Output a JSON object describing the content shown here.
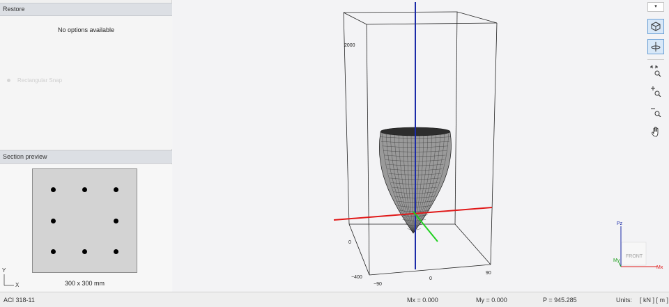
{
  "left_panel": {
    "restore": {
      "header": "Restore",
      "empty_message": "No options available",
      "snap_label": "Rectangular Snap"
    },
    "preview": {
      "header": "Section preview",
      "caption": "300 x 300 mm",
      "axis_y": "Y",
      "axis_x": "X",
      "rebars": [
        [
          0.2,
          0.2
        ],
        [
          0.5,
          0.2
        ],
        [
          0.8,
          0.2
        ],
        [
          0.2,
          0.5
        ],
        [
          0.8,
          0.5
        ],
        [
          0.2,
          0.8
        ],
        [
          0.5,
          0.8
        ],
        [
          0.8,
          0.8
        ]
      ]
    }
  },
  "viewport": {
    "tick_z": "2000",
    "tick_origin": "0",
    "tick_neg400": "−400",
    "tick_neg90": "−90",
    "tick_zero_x": "0",
    "tick_90": "90",
    "orient": {
      "pz": "Pz",
      "mx": "Mx",
      "my": "My",
      "cube": "FRONT"
    },
    "colors": {
      "z_axis": "#1a2aa8",
      "x_axis": "#e01818",
      "y_axis": "#20d020",
      "surface": "#9a9a9a",
      "mesh": "#2b2b2b"
    }
  },
  "toolbar": {
    "dropdown": "▾",
    "buttons": [
      "3d-view",
      "rotate",
      "zoom-extents",
      "zoom-in",
      "zoom-out",
      "pan"
    ]
  },
  "status": {
    "code": "ACI 318-11",
    "mx": "Mx = 0.000",
    "my": "My = 0.000",
    "p": "P = 945.285",
    "units_label": "Units:",
    "units_value": "[ kN ] [ m ]"
  }
}
